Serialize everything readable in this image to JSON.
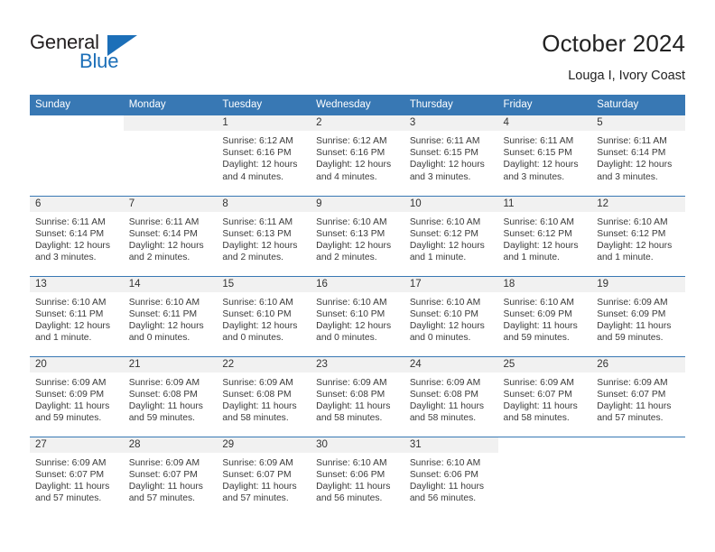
{
  "brand": {
    "name_top": "General",
    "name_bottom": "Blue",
    "flag_icon": "triangle-flag-icon",
    "accent_color": "#1c6fb8"
  },
  "header": {
    "title": "October 2024",
    "subtitle": "Louga I, Ivory Coast"
  },
  "colors": {
    "header_blue": "#3878b4",
    "daynum_band": "#f1f1f1",
    "text": "#3a3a3a"
  },
  "weekday_headers": [
    "Sunday",
    "Monday",
    "Tuesday",
    "Wednesday",
    "Thursday",
    "Friday",
    "Saturday"
  ],
  "labels": {
    "sunrise_prefix": "Sunrise:",
    "sunset_prefix": "Sunset:",
    "daylight_prefix": "Daylight:"
  },
  "weeks": [
    [
      {
        "day": "",
        "sunrise": "",
        "sunset": "",
        "daylight": "",
        "blank": true
      },
      {
        "day": "",
        "sunrise": "",
        "sunset": "",
        "daylight": "",
        "blank": false
      },
      {
        "day": "1",
        "sunrise": "Sunrise: 6:12 AM",
        "sunset": "Sunset: 6:16 PM",
        "daylight": "Daylight: 12 hours and 4 minutes."
      },
      {
        "day": "2",
        "sunrise": "Sunrise: 6:12 AM",
        "sunset": "Sunset: 6:16 PM",
        "daylight": "Daylight: 12 hours and 4 minutes."
      },
      {
        "day": "3",
        "sunrise": "Sunrise: 6:11 AM",
        "sunset": "Sunset: 6:15 PM",
        "daylight": "Daylight: 12 hours and 3 minutes."
      },
      {
        "day": "4",
        "sunrise": "Sunrise: 6:11 AM",
        "sunset": "Sunset: 6:15 PM",
        "daylight": "Daylight: 12 hours and 3 minutes."
      },
      {
        "day": "5",
        "sunrise": "Sunrise: 6:11 AM",
        "sunset": "Sunset: 6:14 PM",
        "daylight": "Daylight: 12 hours and 3 minutes."
      }
    ],
    [
      {
        "day": "6",
        "sunrise": "Sunrise: 6:11 AM",
        "sunset": "Sunset: 6:14 PM",
        "daylight": "Daylight: 12 hours and 3 minutes."
      },
      {
        "day": "7",
        "sunrise": "Sunrise: 6:11 AM",
        "sunset": "Sunset: 6:14 PM",
        "daylight": "Daylight: 12 hours and 2 minutes."
      },
      {
        "day": "8",
        "sunrise": "Sunrise: 6:11 AM",
        "sunset": "Sunset: 6:13 PM",
        "daylight": "Daylight: 12 hours and 2 minutes."
      },
      {
        "day": "9",
        "sunrise": "Sunrise: 6:10 AM",
        "sunset": "Sunset: 6:13 PM",
        "daylight": "Daylight: 12 hours and 2 minutes."
      },
      {
        "day": "10",
        "sunrise": "Sunrise: 6:10 AM",
        "sunset": "Sunset: 6:12 PM",
        "daylight": "Daylight: 12 hours and 1 minute."
      },
      {
        "day": "11",
        "sunrise": "Sunrise: 6:10 AM",
        "sunset": "Sunset: 6:12 PM",
        "daylight": "Daylight: 12 hours and 1 minute."
      },
      {
        "day": "12",
        "sunrise": "Sunrise: 6:10 AM",
        "sunset": "Sunset: 6:12 PM",
        "daylight": "Daylight: 12 hours and 1 minute."
      }
    ],
    [
      {
        "day": "13",
        "sunrise": "Sunrise: 6:10 AM",
        "sunset": "Sunset: 6:11 PM",
        "daylight": "Daylight: 12 hours and 1 minute."
      },
      {
        "day": "14",
        "sunrise": "Sunrise: 6:10 AM",
        "sunset": "Sunset: 6:11 PM",
        "daylight": "Daylight: 12 hours and 0 minutes."
      },
      {
        "day": "15",
        "sunrise": "Sunrise: 6:10 AM",
        "sunset": "Sunset: 6:10 PM",
        "daylight": "Daylight: 12 hours and 0 minutes."
      },
      {
        "day": "16",
        "sunrise": "Sunrise: 6:10 AM",
        "sunset": "Sunset: 6:10 PM",
        "daylight": "Daylight: 12 hours and 0 minutes."
      },
      {
        "day": "17",
        "sunrise": "Sunrise: 6:10 AM",
        "sunset": "Sunset: 6:10 PM",
        "daylight": "Daylight: 12 hours and 0 minutes."
      },
      {
        "day": "18",
        "sunrise": "Sunrise: 6:10 AM",
        "sunset": "Sunset: 6:09 PM",
        "daylight": "Daylight: 11 hours and 59 minutes."
      },
      {
        "day": "19",
        "sunrise": "Sunrise: 6:09 AM",
        "sunset": "Sunset: 6:09 PM",
        "daylight": "Daylight: 11 hours and 59 minutes."
      }
    ],
    [
      {
        "day": "20",
        "sunrise": "Sunrise: 6:09 AM",
        "sunset": "Sunset: 6:09 PM",
        "daylight": "Daylight: 11 hours and 59 minutes."
      },
      {
        "day": "21",
        "sunrise": "Sunrise: 6:09 AM",
        "sunset": "Sunset: 6:08 PM",
        "daylight": "Daylight: 11 hours and 59 minutes."
      },
      {
        "day": "22",
        "sunrise": "Sunrise: 6:09 AM",
        "sunset": "Sunset: 6:08 PM",
        "daylight": "Daylight: 11 hours and 58 minutes."
      },
      {
        "day": "23",
        "sunrise": "Sunrise: 6:09 AM",
        "sunset": "Sunset: 6:08 PM",
        "daylight": "Daylight: 11 hours and 58 minutes."
      },
      {
        "day": "24",
        "sunrise": "Sunrise: 6:09 AM",
        "sunset": "Sunset: 6:08 PM",
        "daylight": "Daylight: 11 hours and 58 minutes."
      },
      {
        "day": "25",
        "sunrise": "Sunrise: 6:09 AM",
        "sunset": "Sunset: 6:07 PM",
        "daylight": "Daylight: 11 hours and 58 minutes."
      },
      {
        "day": "26",
        "sunrise": "Sunrise: 6:09 AM",
        "sunset": "Sunset: 6:07 PM",
        "daylight": "Daylight: 11 hours and 57 minutes."
      }
    ],
    [
      {
        "day": "27",
        "sunrise": "Sunrise: 6:09 AM",
        "sunset": "Sunset: 6:07 PM",
        "daylight": "Daylight: 11 hours and 57 minutes."
      },
      {
        "day": "28",
        "sunrise": "Sunrise: 6:09 AM",
        "sunset": "Sunset: 6:07 PM",
        "daylight": "Daylight: 11 hours and 57 minutes."
      },
      {
        "day": "29",
        "sunrise": "Sunrise: 6:09 AM",
        "sunset": "Sunset: 6:07 PM",
        "daylight": "Daylight: 11 hours and 57 minutes."
      },
      {
        "day": "30",
        "sunrise": "Sunrise: 6:10 AM",
        "sunset": "Sunset: 6:06 PM",
        "daylight": "Daylight: 11 hours and 56 minutes."
      },
      {
        "day": "31",
        "sunrise": "Sunrise: 6:10 AM",
        "sunset": "Sunset: 6:06 PM",
        "daylight": "Daylight: 11 hours and 56 minutes."
      },
      {
        "day": "",
        "sunrise": "",
        "sunset": "",
        "daylight": "",
        "blank": true
      },
      {
        "day": "",
        "sunrise": "",
        "sunset": "",
        "daylight": "",
        "blank": true
      }
    ]
  ]
}
